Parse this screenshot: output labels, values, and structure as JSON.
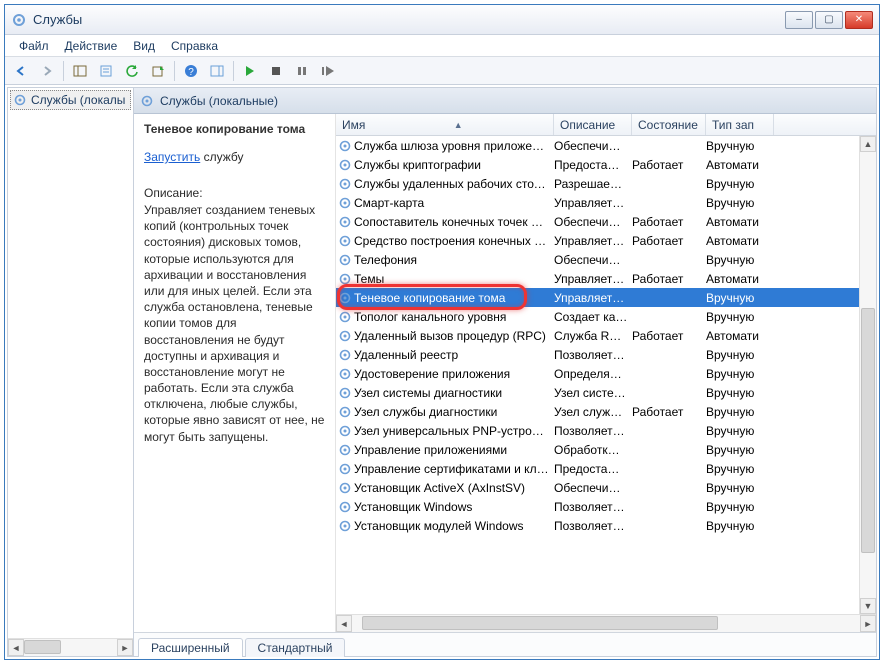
{
  "window": {
    "title": "Службы"
  },
  "menu": {
    "file": "Файл",
    "action": "Действие",
    "view": "Вид",
    "help": "Справка"
  },
  "tree": {
    "root": "Службы (локалы"
  },
  "header": {
    "label": "Службы (локальные)"
  },
  "details": {
    "title": "Теневое копирование тома",
    "start_link": "Запустить",
    "start_suffix": "службу",
    "desc_label": "Описание:",
    "desc_text": "Управляет созданием теневых копий (контрольных точек состояния) дисковых томов, которые используются для архивации и восстановления или для иных целей. Если эта служба остановлена, теневые копии томов для восстановления не будут доступны и архивация и восстановление могут не работать. Если эта служба отключена, любые службы, которые явно зависят от нее, не могут быть запущены."
  },
  "columns": {
    "name": "Имя",
    "desc": "Описание",
    "state": "Состояние",
    "start": "Тип зап"
  },
  "services": [
    {
      "name": "Служба шлюза уровня приложен…",
      "desc": "Обеспечи…",
      "state": "",
      "start": "Вручную"
    },
    {
      "name": "Службы криптографии",
      "desc": "Предоста…",
      "state": "Работает",
      "start": "Автомати"
    },
    {
      "name": "Службы удаленных рабочих стол…",
      "desc": "Разрешае…",
      "state": "",
      "start": "Вручную"
    },
    {
      "name": "Смарт-карта",
      "desc": "Управляет…",
      "state": "",
      "start": "Вручную"
    },
    {
      "name": "Сопоставитель конечных точек R…",
      "desc": "Обеспечи…",
      "state": "Работает",
      "start": "Автомати"
    },
    {
      "name": "Средство построения конечных т…",
      "desc": "Управляет…",
      "state": "Работает",
      "start": "Автомати"
    },
    {
      "name": "Телефония",
      "desc": "Обеспечи…",
      "state": "",
      "start": "Вручную"
    },
    {
      "name": "Темы",
      "desc": "Управляет…",
      "state": "Работает",
      "start": "Автомати"
    },
    {
      "name": "Теневое копирование тома",
      "desc": "Управляет…",
      "state": "",
      "start": "Вручную",
      "selected": true
    },
    {
      "name": "Тополог канального уровня",
      "desc": "Создает ка…",
      "state": "",
      "start": "Вручную"
    },
    {
      "name": "Удаленный вызов процедур (RPC)",
      "desc": "Служба R…",
      "state": "Работает",
      "start": "Автомати"
    },
    {
      "name": "Удаленный реестр",
      "desc": "Позволяет…",
      "state": "",
      "start": "Вручную"
    },
    {
      "name": "Удостоверение приложения",
      "desc": "Определя…",
      "state": "",
      "start": "Вручную"
    },
    {
      "name": "Узел системы диагностики",
      "desc": "Узел систе…",
      "state": "",
      "start": "Вручную"
    },
    {
      "name": "Узел службы диагностики",
      "desc": "Узел служ…",
      "state": "Работает",
      "start": "Вручную"
    },
    {
      "name": "Узел универсальных PNP-устройс…",
      "desc": "Позволяет…",
      "state": "",
      "start": "Вручную"
    },
    {
      "name": "Управление приложениями",
      "desc": "Обработк…",
      "state": "",
      "start": "Вручную"
    },
    {
      "name": "Управление сертификатами и кл…",
      "desc": "Предоста…",
      "state": "",
      "start": "Вручную"
    },
    {
      "name": "Установщик ActiveX (AxInstSV)",
      "desc": "Обеспечи…",
      "state": "",
      "start": "Вручную"
    },
    {
      "name": "Установщик Windows",
      "desc": "Позволяет…",
      "state": "",
      "start": "Вручную"
    },
    {
      "name": "Установщик модулей Windows",
      "desc": "Позволяет…",
      "state": "",
      "start": "Вручную"
    }
  ],
  "tabs": {
    "extended": "Расширенный",
    "standard": "Стандартный"
  }
}
